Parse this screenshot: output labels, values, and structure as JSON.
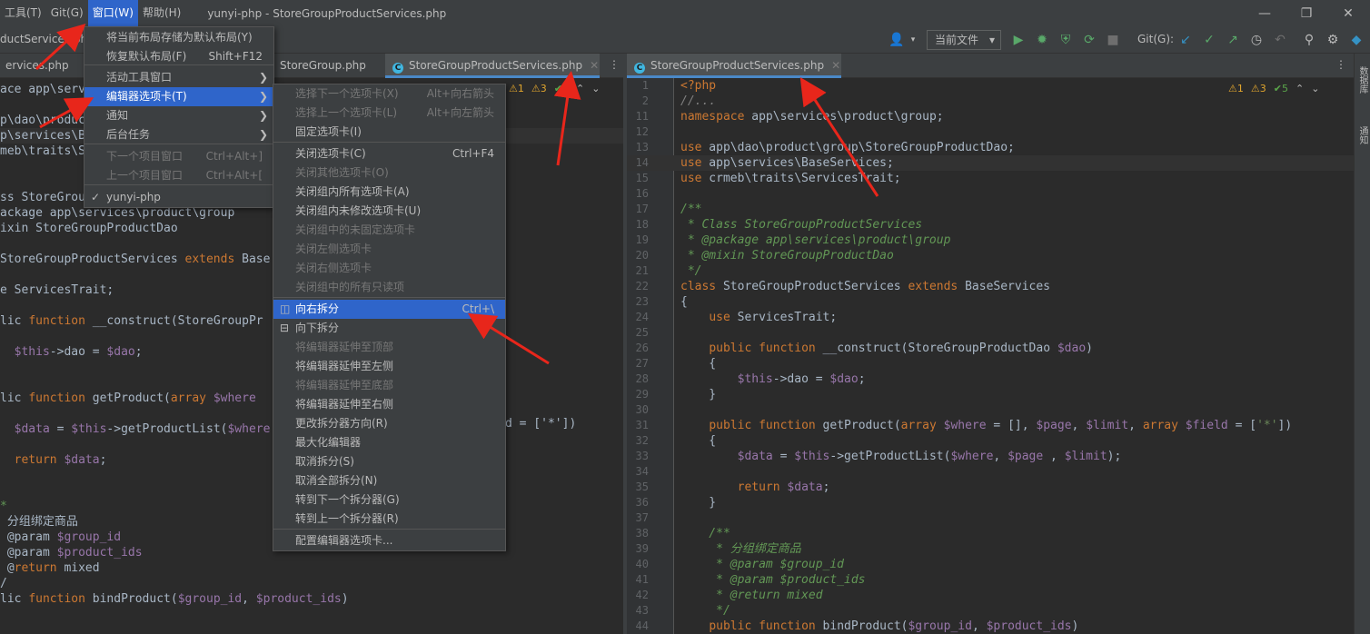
{
  "menubar": {
    "items": [
      {
        "label": "工具(T)"
      },
      {
        "label": "Git(G)"
      },
      {
        "label": "窗口(W)"
      },
      {
        "label": "帮助(H)"
      }
    ],
    "title": "yunyi-php - StoreGroupProductServices.php"
  },
  "window_controls": {
    "minimize": "—",
    "maximize": "❐",
    "close": "✕"
  },
  "toolbar": {
    "file_tab_partial": "ductServices.php",
    "run_config": "当前文件",
    "run_config_arrow": "▾",
    "git_label": "Git(G):"
  },
  "left_editor": {
    "tabs": [
      {
        "label": "ervices.php"
      },
      {
        "label": "StoreGroup.php"
      },
      {
        "label": "StoreGroupProductServices.php"
      }
    ],
    "inspections": {
      "warn1": "⚠1",
      "warn2": "⚠3",
      "ok": "✔5"
    },
    "lines": [
      "ace app\\serv",
      "",
      "p\\dao\\produc",
      "p\\services\\B",
      "meb\\traits\\S",
      "",
      "",
      "ss StoreGroupProductServices",
      "ackage app\\services\\product\\group",
      "ixin StoreGroupProductDao",
      "",
      "StoreGroupProductServices extends Base",
      "",
      "e ServicesTrait;",
      "",
      "lic function __construct(StoreGroupPr",
      "",
      "  $this->dao = $dao;",
      "",
      "",
      "lic function getProduct(array $where",
      "",
      "  $data = $this->getProductList($where",
      "",
      "  return $data;",
      "",
      "",
      "*",
      " 分组绑定商品",
      " @param $group_id",
      " @param $product_ids",
      " @return mixed",
      "/",
      "lic function bindProduct($group_id, $product_ids)"
    ],
    "partial_right": "d = ['*'])"
  },
  "right_editor": {
    "tab": "StoreGroupProductServices.php",
    "inspections": {
      "warn1": "⚠1",
      "warn2": "⚠3",
      "ok": "✔5"
    },
    "lines": [
      {
        "n": "1",
        "t": "<?php"
      },
      {
        "n": "2",
        "t": "//..."
      },
      {
        "n": "11",
        "t": "namespace app\\services\\product\\group;"
      },
      {
        "n": "12",
        "t": ""
      },
      {
        "n": "13",
        "t": "use app\\dao\\product\\group\\StoreGroupProductDao;"
      },
      {
        "n": "14",
        "t": "use app\\services\\BaseServices;"
      },
      {
        "n": "15",
        "t": "use crmeb\\traits\\ServicesTrait;"
      },
      {
        "n": "16",
        "t": ""
      },
      {
        "n": "17",
        "t": "/**"
      },
      {
        "n": "18",
        "t": " * Class StoreGroupProductServices"
      },
      {
        "n": "19",
        "t": " * @package app\\services\\product\\group"
      },
      {
        "n": "20",
        "t": " * @mixin StoreGroupProductDao"
      },
      {
        "n": "21",
        "t": " */"
      },
      {
        "n": "22",
        "t": "class StoreGroupProductServices extends BaseServices"
      },
      {
        "n": "23",
        "t": "{"
      },
      {
        "n": "24",
        "t": "    use ServicesTrait;"
      },
      {
        "n": "25",
        "t": ""
      },
      {
        "n": "26",
        "t": "    public function __construct(StoreGroupProductDao $dao)"
      },
      {
        "n": "27",
        "t": "    {"
      },
      {
        "n": "28",
        "t": "        $this->dao = $dao;"
      },
      {
        "n": "29",
        "t": "    }"
      },
      {
        "n": "30",
        "t": ""
      },
      {
        "n": "31",
        "t": "    public function getProduct(array $where = [], $page, $limit, array $field = ['*'])"
      },
      {
        "n": "32",
        "t": "    {"
      },
      {
        "n": "33",
        "t": "        $data = $this->getProductList($where, $page , $limit);"
      },
      {
        "n": "34",
        "t": ""
      },
      {
        "n": "35",
        "t": "        return $data;"
      },
      {
        "n": "36",
        "t": "    }"
      },
      {
        "n": "37",
        "t": ""
      },
      {
        "n": "38",
        "t": "    /**"
      },
      {
        "n": "39",
        "t": "     * 分组绑定商品"
      },
      {
        "n": "40",
        "t": "     * @param $group_id"
      },
      {
        "n": "41",
        "t": "     * @param $product_ids"
      },
      {
        "n": "42",
        "t": "     * @return mixed"
      },
      {
        "n": "43",
        "t": "     */"
      },
      {
        "n": "44",
        "t": "    public function bindProduct($group_id, $product_ids)"
      }
    ]
  },
  "right_strip": {
    "label1": "数据库",
    "label2": "通知"
  },
  "window_menu": {
    "items": [
      {
        "label": "将当前布局存储为默认布局(Y)",
        "shortcut": ""
      },
      {
        "label": "恢复默认布局(F)",
        "shortcut": "Shift+F12"
      },
      {
        "label": "活动工具窗口",
        "shortcut": ""
      },
      {
        "label": "编辑器选项卡(T)",
        "shortcut": ""
      },
      {
        "label": "通知",
        "shortcut": ""
      },
      {
        "label": "后台任务",
        "shortcut": ""
      },
      {
        "label": "下一个项目窗口",
        "shortcut": "Ctrl+Alt+]"
      },
      {
        "label": "上一个项目窗口",
        "shortcut": "Ctrl+Alt+["
      },
      {
        "label": "yunyi-php",
        "shortcut": ""
      }
    ],
    "check": "✓",
    "arrow": "❯"
  },
  "tabs_submenu": {
    "items": [
      {
        "label": "选择下一个选项卡(X)",
        "shortcut": "Alt+向右箭头"
      },
      {
        "label": "选择上一个选项卡(L)",
        "shortcut": "Alt+向左箭头"
      },
      {
        "label": "固定选项卡(I)",
        "shortcut": ""
      },
      {
        "label": "关闭选项卡(C)",
        "shortcut": "Ctrl+F4"
      },
      {
        "label": "关闭其他选项卡(O)",
        "shortcut": ""
      },
      {
        "label": "关闭组内所有选项卡(A)",
        "shortcut": ""
      },
      {
        "label": "关闭组内未修改选项卡(U)",
        "shortcut": ""
      },
      {
        "label": "关闭组中的未固定选项卡",
        "shortcut": ""
      },
      {
        "label": "关闭左侧选项卡",
        "shortcut": ""
      },
      {
        "label": "关闭右侧选项卡",
        "shortcut": ""
      },
      {
        "label": "关闭组中的所有只读项",
        "shortcut": ""
      },
      {
        "label": "向右拆分",
        "shortcut": "Ctrl+\\"
      },
      {
        "label": "向下拆分",
        "shortcut": ""
      },
      {
        "label": "将编辑器延伸至顶部",
        "shortcut": ""
      },
      {
        "label": "将编辑器延伸至左侧",
        "shortcut": ""
      },
      {
        "label": "将编辑器延伸至底部",
        "shortcut": ""
      },
      {
        "label": "将编辑器延伸至右侧",
        "shortcut": ""
      },
      {
        "label": "更改拆分器方向(R)",
        "shortcut": ""
      },
      {
        "label": "最大化编辑器",
        "shortcut": ""
      },
      {
        "label": "取消拆分(S)",
        "shortcut": ""
      },
      {
        "label": "取消全部拆分(N)",
        "shortcut": ""
      },
      {
        "label": "转到下一个拆分器(G)",
        "shortcut": ""
      },
      {
        "label": "转到上一个拆分器(R)",
        "shortcut": ""
      },
      {
        "label": "配置编辑器选项卡...",
        "shortcut": ""
      }
    ],
    "split_right_icon": "◫",
    "split_down_icon": "⊟"
  },
  "colors": {
    "accent": "#2f65ca",
    "annotation": "#e8261b",
    "background": "#2b2b2b"
  }
}
